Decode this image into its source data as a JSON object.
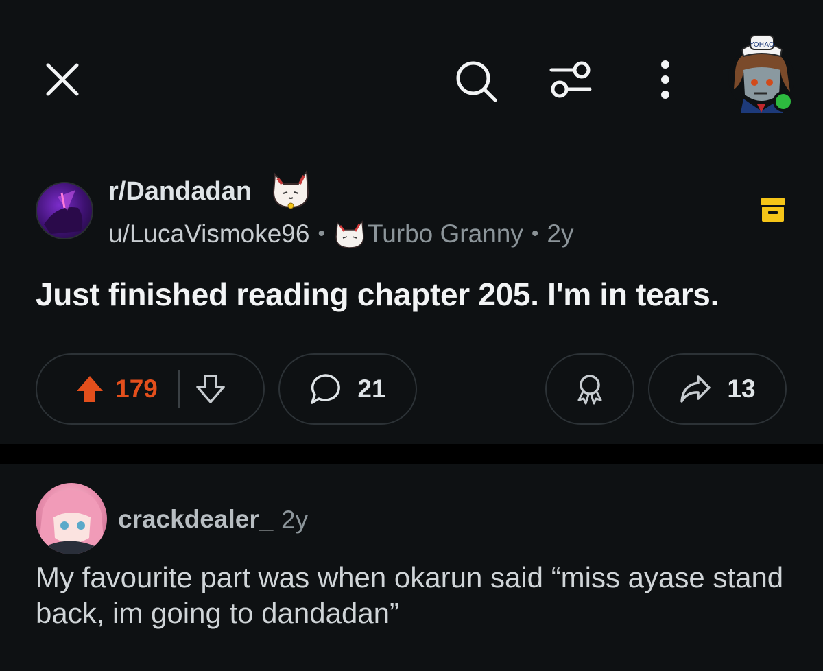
{
  "topbar": {
    "icons": [
      "close-icon",
      "search-icon",
      "filter-icon",
      "more-vertical-icon"
    ],
    "avatar_hat_text": "YOHAO",
    "online_status_color": "#2dba3f"
  },
  "post": {
    "subreddit": "r/Dandadan",
    "author": "u/LucaVismoke96",
    "flair": "Turbo Granny",
    "age": "2y",
    "title": "Just finished reading chapter 205. I'm in tears.",
    "upvotes": "179",
    "comments": "21",
    "shares": "13",
    "upvote_color": "#e34f1c",
    "archive_color": "#f5c518"
  },
  "comment": {
    "username": "crackdealer_",
    "age": "2y",
    "body": "My favourite part was when okarun said “miss ayase stand back, im going to dandadan”"
  },
  "colors": {
    "background": "#0e1113",
    "pill_border": "#2c3236",
    "divider": "#000000"
  }
}
